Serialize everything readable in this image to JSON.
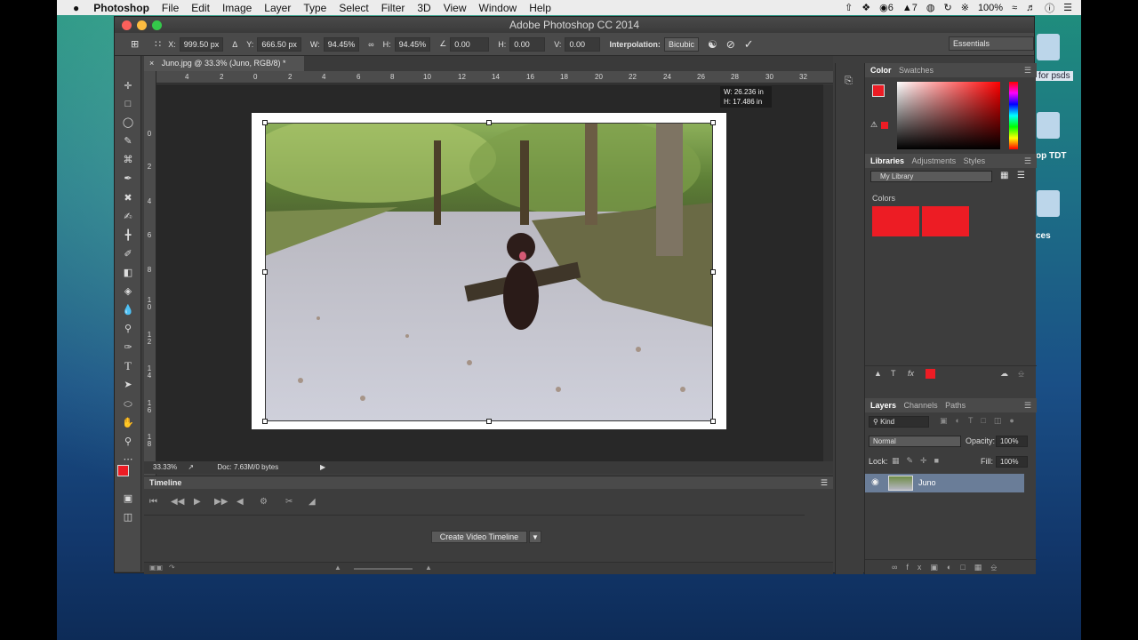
{
  "menubar": {
    "app": "Photoshop",
    "items": [
      "File",
      "Edit",
      "Image",
      "Layer",
      "Type",
      "Select",
      "Filter",
      "3D",
      "View",
      "Window",
      "Help"
    ],
    "status": {
      "notif": "6",
      "a7": "7",
      "battery": "100%"
    }
  },
  "window": {
    "title": "Adobe Photoshop CC 2014"
  },
  "options": {
    "x_label": "X:",
    "x_value": "999.50 px",
    "y_label": "Y:",
    "y_value": "666.50 px",
    "w_label": "W:",
    "w_value": "94.45%",
    "h_label": "H:",
    "h_value": "94.45%",
    "angle_value": "0.00",
    "hskew_label": "H:",
    "hskew_value": "0.00",
    "vskew_label": "V:",
    "vskew_value": "0.00",
    "interp_label": "Interpolation:",
    "interp_value": "Bicubic",
    "workspace": "Essentials"
  },
  "document": {
    "tab": "Juno.jpg @ 33.3% (Juno, RGB/8) *",
    "zoom": "33.33%",
    "docsize": "Doc: 7.63M/0 bytes",
    "ruler_h": [
      "4",
      "2",
      "0",
      "2",
      "4",
      "6",
      "8",
      "10",
      "12",
      "14",
      "16",
      "18",
      "20",
      "22",
      "24",
      "26",
      "28",
      "30",
      "32"
    ],
    "ruler_v": [
      "0",
      "2",
      "4",
      "6",
      "8",
      "1 0",
      "1 2",
      "1 4",
      "1 6",
      "1 8"
    ],
    "tooltip_w": "W: 26.236 in",
    "tooltip_h": "H: 17.486 in"
  },
  "timeline": {
    "title": "Timeline",
    "create_button": "Create Video Timeline"
  },
  "panels": {
    "color_tabs": [
      "Color",
      "Swatches"
    ],
    "libraries_tabs": [
      "Libraries",
      "Adjustments",
      "Styles"
    ],
    "library_select": "My Library",
    "colors_label": "Colors",
    "layers_tabs": [
      "Layers",
      "Channels",
      "Paths"
    ],
    "kind": "Kind",
    "blend_mode": "Normal",
    "opacity_label": "Opacity:",
    "opacity_value": "100%",
    "lock_label": "Lock:",
    "fill_label": "Fill:",
    "fill_value": "100%",
    "layer_name": "Juno"
  },
  "desktop": {
    "labels": [
      "for psds",
      "op TDT",
      "ces"
    ]
  },
  "colors": {
    "foreground": "#ed1c24",
    "accent_selection": "#6a7d98"
  }
}
